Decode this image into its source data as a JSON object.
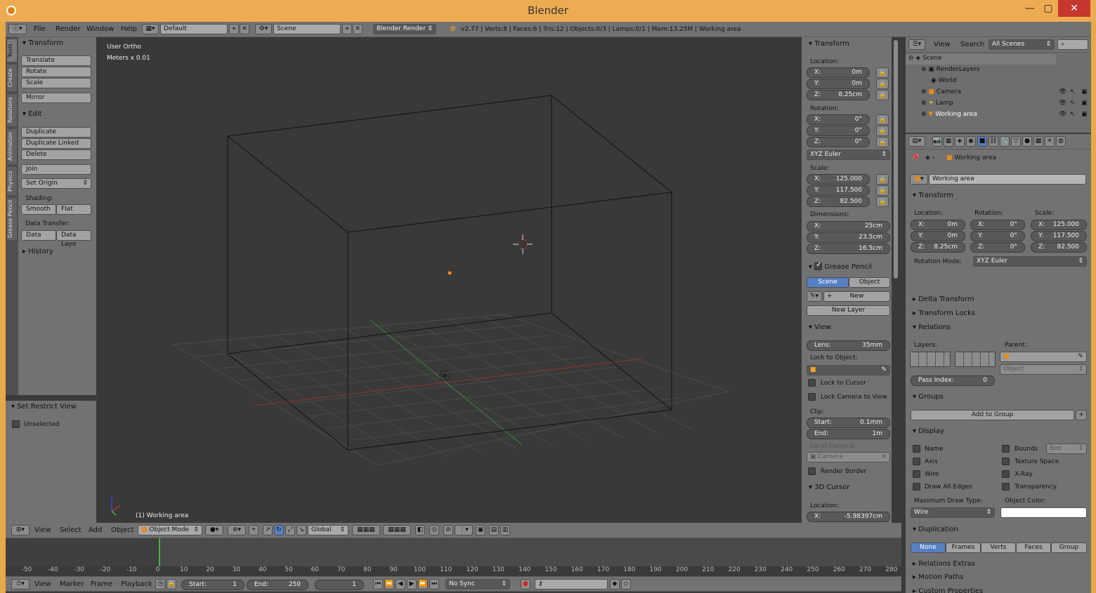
{
  "window": {
    "title": "Blender",
    "min": "—",
    "max": "▢",
    "close": "✕"
  },
  "topbar": {
    "menus": [
      "File",
      "Render",
      "Window",
      "Help"
    ],
    "layout": "Default",
    "scene": "Scene",
    "engine": "Blender Render",
    "stats": "v2.77 | Verts:8 | Faces:6 | Tris:12 | Objects:0/3 | Lamps:0/1 | Mem:13.25M | Working area"
  },
  "tool_tabs": [
    "Tools",
    "Create",
    "Relations",
    "Animation",
    "Physics",
    "Grease Pencil"
  ],
  "toolshelf": {
    "transform_title": "Transform",
    "translate": "Translate",
    "rotate": "Rotate",
    "scale": "Scale",
    "mirror": "Mirror",
    "edit_title": "Edit",
    "duplicate": "Duplicate",
    "duplicate_linked": "Duplicate Linked",
    "delete": "Delete",
    "join": "Join",
    "set_origin": "Set Origin",
    "shading_label": "Shading:",
    "smooth": "Smooth",
    "flat": "Flat",
    "data_transfer_label": "Data Transfer:",
    "data": "Data",
    "data_layout": "Data Layo",
    "history": "History",
    "restrict_title": "Set Restrict View",
    "unselected": "Unselected"
  },
  "viewport": {
    "view_name": "User Ortho",
    "units": "Meters x 0.01",
    "object_label": "(1) Working area"
  },
  "npanel": {
    "transform_title": "Transform",
    "location_label": "Location:",
    "loc": [
      {
        "k": "X:",
        "v": "0m"
      },
      {
        "k": "Y:",
        "v": "0m"
      },
      {
        "k": "Z:",
        "v": "8.25cm"
      }
    ],
    "rotation_label": "Rotation:",
    "rot": [
      {
        "k": "X:",
        "v": "0°"
      },
      {
        "k": "Y:",
        "v": "0°"
      },
      {
        "k": "Z:",
        "v": "0°"
      }
    ],
    "rotation_mode": "XYZ Euler",
    "scale_label": "Scale:",
    "scl": [
      {
        "k": "X:",
        "v": "125.000"
      },
      {
        "k": "Y:",
        "v": "117.500"
      },
      {
        "k": "Z:",
        "v": "82.500"
      }
    ],
    "dimensions_label": "Dimensions:",
    "dim": [
      {
        "k": "X:",
        "v": "25cm"
      },
      {
        "k": "Y:",
        "v": "23.5cm"
      },
      {
        "k": "Z:",
        "v": "16.5cm"
      }
    ],
    "gp_title": "Grease Pencil",
    "gp_scene": "Scene",
    "gp_object": "Object",
    "gp_new": "New",
    "gp_new_layer": "New Layer",
    "view_title": "View",
    "lens_k": "Lens:",
    "lens_v": "35mm",
    "lock_to_object": "Lock to Object:",
    "lock_to_cursor": "Lock to Cursor",
    "lock_camera": "Lock Camera to View",
    "clip_label": "Clip:",
    "clip_start_k": "Start:",
    "clip_start_v": "0.1mm",
    "clip_end_k": "End:",
    "clip_end_v": "1m",
    "local_camera": "Local Camera:",
    "camera": "Camera",
    "render_border": "Render Border",
    "cursor_title": "3D Cursor",
    "cursor_loc_label": "Location:",
    "cursor_x_k": "X:",
    "cursor_x_v": "-5.98397cm"
  },
  "viewport_header": {
    "menus": [
      "View",
      "Select",
      "Add",
      "Object"
    ],
    "mode": "Object Mode",
    "orientation": "Global"
  },
  "outliner": {
    "view": "View",
    "search": "Search",
    "filter": "All Scenes",
    "items": [
      "Scene",
      "RenderLayers",
      "World",
      "Camera",
      "Lamp",
      "Working area"
    ]
  },
  "props": {
    "breadcrumb": "Working area",
    "object_name": "Working area",
    "transform_title": "Transform",
    "location_label": "Location:",
    "rotation_label": "Rotation:",
    "scale_label": "Scale:",
    "loc": [
      {
        "k": "X:",
        "v": "0m"
      },
      {
        "k": "Y:",
        "v": "0m"
      },
      {
        "k": "Z:",
        "v": "8.25cm"
      }
    ],
    "rot": [
      {
        "k": "X:",
        "v": "0°"
      },
      {
        "k": "Y:",
        "v": "0°"
      },
      {
        "k": "Z:",
        "v": "0°"
      }
    ],
    "scl": [
      {
        "k": "X:",
        "v": "125.000"
      },
      {
        "k": "Y:",
        "v": "117.500"
      },
      {
        "k": "Z:",
        "v": "82.500"
      }
    ],
    "rotation_mode_label": "Rotation Mode:",
    "rotation_mode": "XYZ Euler",
    "delta_transform": "Delta Transform",
    "transform_locks": "Transform Locks",
    "relations_title": "Relations",
    "layers_label": "Layers:",
    "parent_label": "Parent:",
    "parent_type": "Object",
    "pass_index_k": "Pass Index:",
    "pass_index_v": "0",
    "groups_title": "Groups",
    "add_to_group": "Add to Group",
    "display_title": "Display",
    "name": "Name",
    "bounds": "Bounds",
    "bounds_type": "Box",
    "axis": "Axis",
    "texture_space": "Texture Space",
    "wire": "Wire",
    "xray": "X-Ray",
    "draw_all_edges": "Draw All Edges",
    "transparency": "Transparency",
    "max_draw_type_label": "Maximum Draw Type:",
    "max_draw_type": "Wire",
    "object_color_label": "Object Color:",
    "duplication_title": "Duplication",
    "dup": [
      "None",
      "Frames",
      "Verts",
      "Faces",
      "Group"
    ],
    "relations_extras": "Relations Extras",
    "motion_paths": "Motion Paths",
    "custom_properties": "Custom Properties"
  },
  "timeline": {
    "ticks": [
      "-50",
      "-40",
      "-30",
      "-20",
      "-10",
      "0",
      "10",
      "20",
      "30",
      "40",
      "50",
      "60",
      "70",
      "80",
      "90",
      "100",
      "110",
      "120",
      "130",
      "140",
      "150",
      "160",
      "170",
      "180",
      "190",
      "200",
      "210",
      "220",
      "230",
      "240",
      "250",
      "260",
      "270",
      "280"
    ],
    "menus": [
      "View",
      "Marker",
      "Frame",
      "Playback"
    ],
    "start_k": "Start:",
    "start_v": "1",
    "end_k": "End:",
    "end_v": "250",
    "current": "1",
    "sync": "No Sync"
  }
}
